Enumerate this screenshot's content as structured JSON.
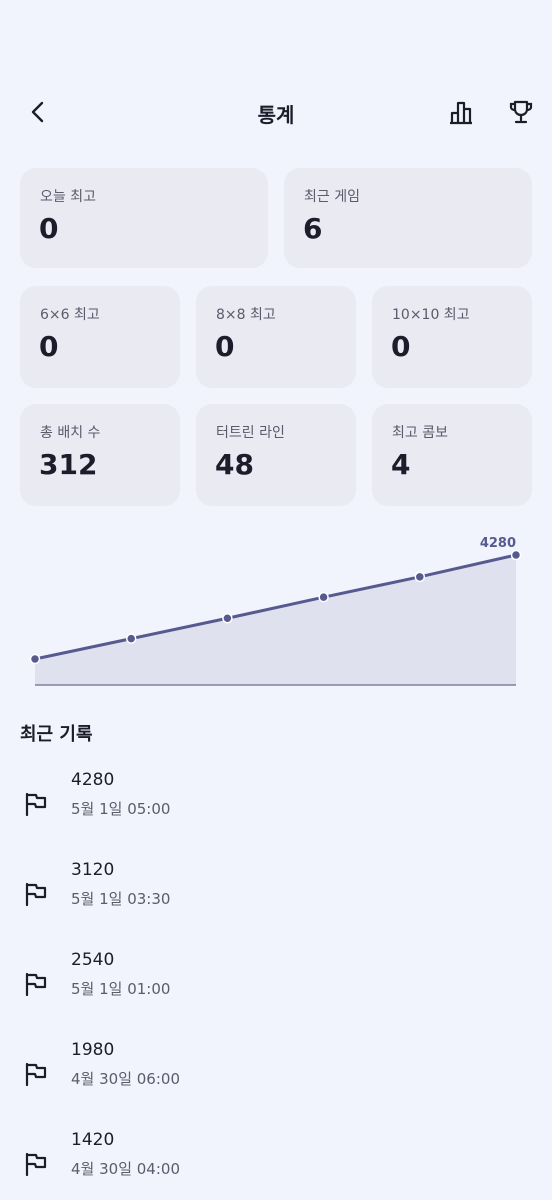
{
  "header": {
    "title": "통계"
  },
  "stats_top": [
    {
      "label": "오늘 최고",
      "value": "0"
    },
    {
      "label": "최근 게임",
      "value": "6"
    }
  ],
  "stats_mid": [
    {
      "label": "6×6 최고",
      "value": "0"
    },
    {
      "label": "8×8 최고",
      "value": "0"
    },
    {
      "label": "10×10 최고",
      "value": "0"
    }
  ],
  "stats_bottom": [
    {
      "label": "총 배치 수",
      "value": "312"
    },
    {
      "label": "터트린 라인",
      "value": "48"
    },
    {
      "label": "최고 콤보",
      "value": "4"
    }
  ],
  "chart_data": {
    "type": "area",
    "values": [
      1420,
      1980,
      2540,
      3120,
      3680,
      4280
    ],
    "last_label": "4280",
    "color": "#575a8f",
    "fill": "#dfe1ee"
  },
  "records": {
    "title": "최근 기록",
    "items": [
      {
        "score": "4280",
        "time": "5월 1일 05:00"
      },
      {
        "score": "3120",
        "time": "5월 1일 03:30"
      },
      {
        "score": "2540",
        "time": "5월 1일 01:00"
      },
      {
        "score": "1980",
        "time": "4월 30일 06:00"
      },
      {
        "score": "1420",
        "time": "4월 30일 04:00"
      }
    ]
  }
}
